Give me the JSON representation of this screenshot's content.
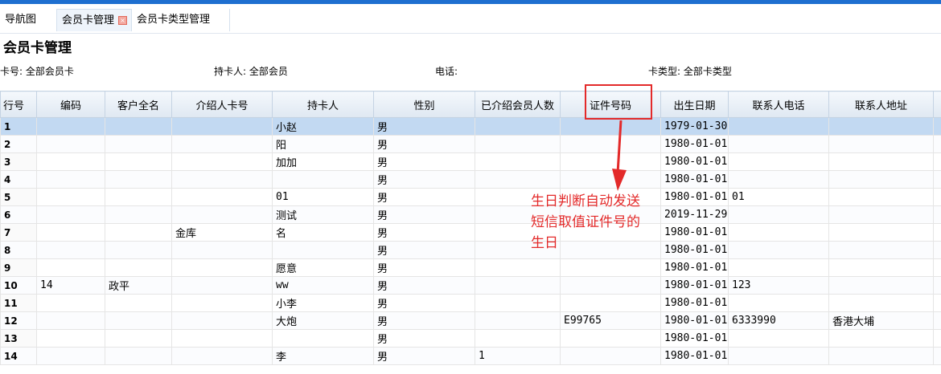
{
  "tabs": [
    {
      "label": "导航图"
    },
    {
      "label": "会员卡管理",
      "close": "×"
    },
    {
      "label": "会员卡类型管理"
    }
  ],
  "page_title": "会员卡管理",
  "filters": {
    "card_no": {
      "label": "卡号:",
      "value": "全部会员卡"
    },
    "holder": {
      "label": "持卡人:",
      "value": "全部会员"
    },
    "phone": {
      "label": "电话:",
      "value": ""
    },
    "card_type": {
      "label": "卡类型:",
      "value": "全部卡类型"
    }
  },
  "table": {
    "columns": [
      "行号",
      "编码",
      "客户全名",
      "介绍人卡号",
      "持卡人",
      "性别",
      "已介绍会员人数",
      "证件号码",
      "出生日期",
      "联系人电话",
      "联系人地址"
    ],
    "rows": [
      [
        "1",
        "",
        "",
        "",
        "小赵",
        "男",
        "",
        "",
        "1979-01-30",
        "",
        ""
      ],
      [
        "2",
        "",
        "",
        "",
        "阳",
        "男",
        "",
        "",
        "1980-01-01",
        "",
        ""
      ],
      [
        "3",
        "",
        "",
        "",
        "加加",
        "男",
        "",
        "",
        "1980-01-01",
        "",
        ""
      ],
      [
        "4",
        "",
        "",
        "",
        "",
        "男",
        "",
        "",
        "1980-01-01",
        "",
        ""
      ],
      [
        "5",
        "",
        "",
        "",
        "01",
        "男",
        "",
        "",
        "1980-01-01",
        "01",
        ""
      ],
      [
        "6",
        "",
        "",
        "",
        "测试",
        "男",
        "",
        "",
        "2019-11-29",
        "",
        ""
      ],
      [
        "7",
        "",
        "",
        "金库",
        "名",
        "男",
        "",
        "",
        "1980-01-01",
        "",
        ""
      ],
      [
        "8",
        "",
        "",
        "",
        "",
        "男",
        "",
        "",
        "1980-01-01",
        "",
        ""
      ],
      [
        "9",
        "",
        "",
        "",
        "愿意",
        "男",
        "",
        "",
        "1980-01-01",
        "",
        ""
      ],
      [
        "10",
        "14",
        "政平",
        "",
        "ww",
        "男",
        "",
        "",
        "1980-01-01",
        "123",
        ""
      ],
      [
        "11",
        "",
        "",
        "",
        "小李",
        "男",
        "",
        "",
        "1980-01-01",
        "",
        ""
      ],
      [
        "12",
        "",
        "",
        "",
        "大炮",
        "男",
        "",
        "E99765",
        "1980-01-01",
        "6333990",
        "香港大埔"
      ],
      [
        "13",
        "",
        "",
        "",
        "",
        "男",
        "",
        "",
        "1980-01-01",
        "",
        ""
      ],
      [
        "14",
        "",
        "",
        "",
        "李",
        "男",
        "1",
        "",
        "1980-01-01",
        "",
        ""
      ]
    ],
    "selected_row": 1
  },
  "annotation": {
    "text": "生日判断自动发送\n短信取值证件号的\n生日",
    "color": "#e32a2a"
  },
  "colors": {
    "accent": "#1e6fd0",
    "selected_row": "#c2d9f2",
    "annotation": "#e32a2a"
  }
}
